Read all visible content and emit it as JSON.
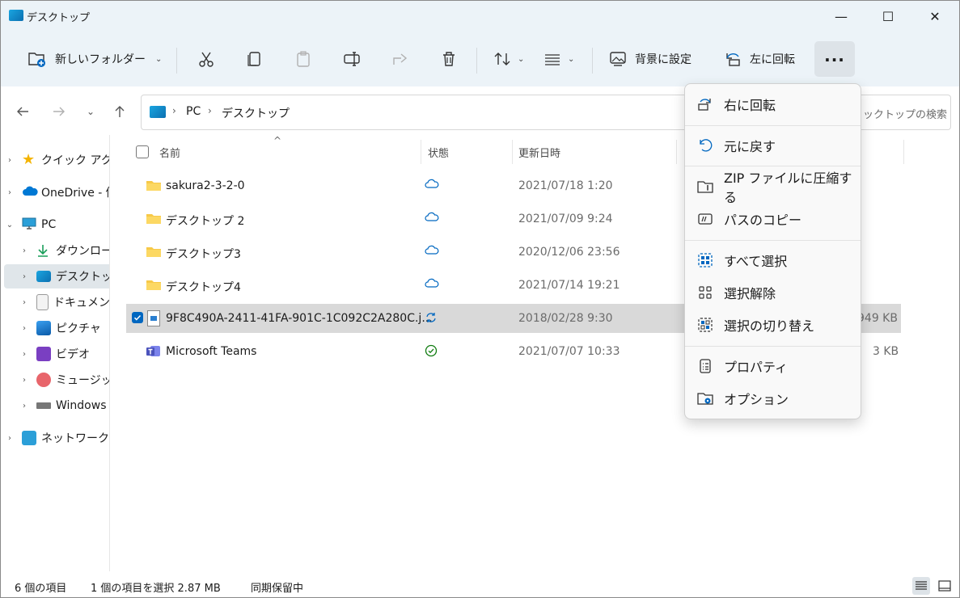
{
  "window": {
    "title": "デスクトップ",
    "minimize": "—",
    "maximize": "☐",
    "close": "✕"
  },
  "toolbar": {
    "new_folder": "新しいフォルダー",
    "set_background": "背景に設定",
    "rotate_left": "左に回転",
    "more": "..."
  },
  "address": {
    "root": "PC",
    "current": "デスクトップ",
    "search_placeholder": "ックトップの検索"
  },
  "sidebar": {
    "items": [
      {
        "label": "クイック アクセス",
        "icon": "star-icon"
      },
      {
        "label": "OneDrive - 個人用",
        "icon": "cloud-icon"
      },
      {
        "label": "PC",
        "icon": "monitor-icon"
      },
      {
        "label": "ダウンロード",
        "icon": "download-icon"
      },
      {
        "label": "デスクトップ",
        "icon": "desktop-icon"
      },
      {
        "label": "ドキュメント",
        "icon": "document-icon"
      },
      {
        "label": "ピクチャ",
        "icon": "picture-icon"
      },
      {
        "label": "ビデオ",
        "icon": "video-icon"
      },
      {
        "label": "ミュージック",
        "icon": "music-icon"
      },
      {
        "label": "Windows (C:)",
        "icon": "drive-icon"
      },
      {
        "label": "ネットワーク",
        "icon": "network-icon"
      }
    ]
  },
  "columns": {
    "name": "名前",
    "status": "状態",
    "modified": "更新日時"
  },
  "files": [
    {
      "name": "sakura2-3-2-0",
      "date": "2021/07/18 1:20",
      "size": "",
      "status": "cloud-icon"
    },
    {
      "name": "デスクトップ 2",
      "date": "2021/07/09 9:24",
      "size": "",
      "status": "cloud-icon"
    },
    {
      "name": "デスクトップ3",
      "date": "2020/12/06 23:56",
      "size": "",
      "status": "cloud-icon"
    },
    {
      "name": "デスクトップ4",
      "date": "2021/07/14 19:21",
      "size": "",
      "status": "cloud-icon"
    },
    {
      "name": "9F8C490A-2411-41FA-901C-1C092C2A280C.j...",
      "date": "2018/02/28 9:30",
      "size": "949 KB",
      "status": "sync-icon"
    },
    {
      "name": "Microsoft Teams",
      "date": "2021/07/07 10:33",
      "size": "3 KB",
      "status": "check-circle-icon"
    }
  ],
  "context_menu": {
    "items": [
      {
        "label": "右に回転",
        "icon": "rotate-right-icon"
      },
      {
        "label": "元に戻す",
        "icon": "undo-icon"
      },
      {
        "label": "ZIP ファイルに圧縮する",
        "icon": "zip-icon"
      },
      {
        "label": "パスのコピー",
        "icon": "copy-path-icon"
      },
      {
        "label": "すべて選択",
        "icon": "select-all-icon"
      },
      {
        "label": "選択解除",
        "icon": "select-none-icon"
      },
      {
        "label": "選択の切り替え",
        "icon": "invert-selection-icon"
      },
      {
        "label": "プロパティ",
        "icon": "properties-icon"
      },
      {
        "label": "オプション",
        "icon": "options-icon"
      }
    ]
  },
  "status": {
    "count": "6 個の項目",
    "selection": "1 個の項目を選択  2.87 MB",
    "sync": "同期保留中"
  },
  "colors": {
    "chrome": "#ecf3f8",
    "selection": "#d9d9d9",
    "accent": "#0067c0",
    "folder": "#f7c948"
  }
}
